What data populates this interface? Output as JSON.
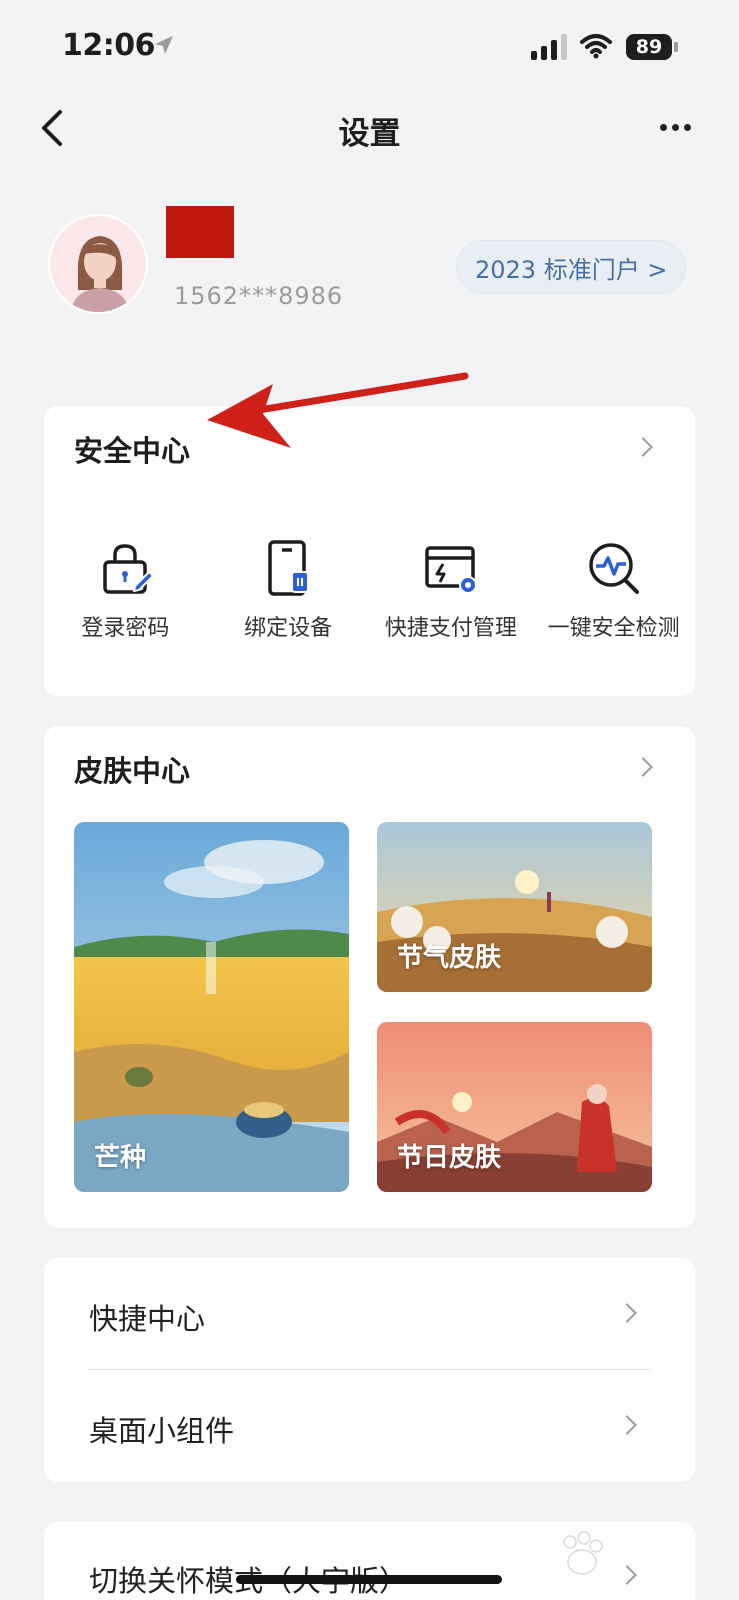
{
  "status_bar": {
    "time": "12:06",
    "battery": "89"
  },
  "nav": {
    "title": "设置"
  },
  "profile": {
    "phone": "1562***8986",
    "portal_label": "2023 标准门户 >"
  },
  "security_center": {
    "title": "安全中心",
    "items": [
      {
        "label": "登录密码",
        "icon": "lock-edit-icon"
      },
      {
        "label": "绑定设备",
        "icon": "phone-device-icon"
      },
      {
        "label": "快捷支付管理",
        "icon": "payment-card-icon"
      },
      {
        "label": "一键安全检测",
        "icon": "security-scan-icon"
      }
    ]
  },
  "skin_center": {
    "title": "皮肤中心",
    "tiles": [
      {
        "label": "芒种"
      },
      {
        "label": "节气皮肤"
      },
      {
        "label": "节日皮肤"
      }
    ]
  },
  "list": {
    "items": [
      {
        "label": "快捷中心"
      },
      {
        "label": "桌面小组件"
      }
    ]
  },
  "care_mode": {
    "label": "切换关怀模式（大字版）"
  },
  "colors": {
    "accent_blue": "#2f5fd7",
    "annotation_red": "#d0201a",
    "name_redaction": "#c0170f"
  }
}
